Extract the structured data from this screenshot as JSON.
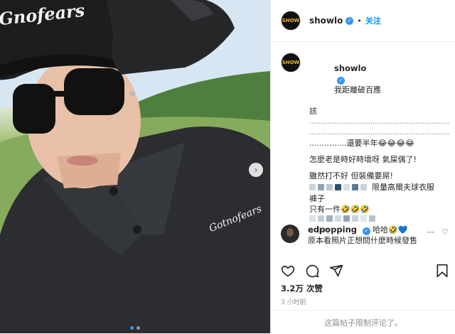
{
  "post": {
    "username": "showlo",
    "avatar_text": "SHOW",
    "follow_label": "关注",
    "separator": "•"
  },
  "caption": {
    "username": "showlo",
    "line1": "我距離破百應",
    "line2": "該",
    "dotted1": "..............................................................",
    "dotted2": "..............................................................",
    "dotted3": "...............還要半年",
    "emoji_laugh": "😂😂😂😂",
    "line3": "怎麼老是時好時壞呀 氣屎偶了!",
    "line4": "雖然打不好 但裝備要屌!",
    "line5": "限量高爾夫球衣服",
    "line6": "褲子",
    "line7": "只有一件",
    "emoji_smile": "🤣🤣🤣",
    "time": "3 小时"
  },
  "comment": {
    "username": "edpopping",
    "text1": "哈哈",
    "emoji": "🤣💙",
    "text2": "原本看照片正想問什麼時候發售"
  },
  "stats": {
    "views": "3.2万 次赞",
    "time": "3 小时前"
  },
  "footer": {
    "text": "这篇帖子限制评论了。"
  },
  "colors": {
    "accent": "#0095f6",
    "verified": "#3897f0",
    "muted": "#8e8e8e"
  },
  "photo_text": {
    "cap_logo": "Gnofears",
    "shirt_logo": "Gotnofears"
  }
}
